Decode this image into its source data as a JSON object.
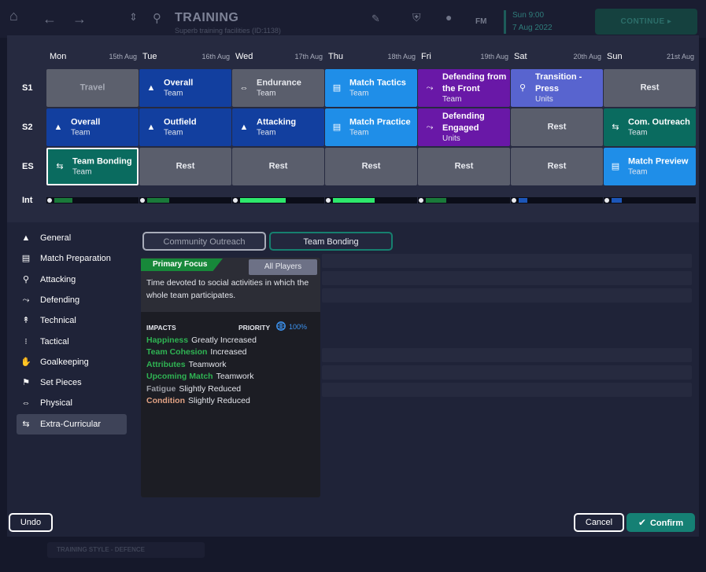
{
  "header": {
    "title": "TRAINING",
    "subtitle": "Superb training facilities (ID:1138)",
    "date_line1": "Sun 9:00",
    "date_line2": "7 Aug 2022",
    "fm": "FM",
    "continue_label": "CONTINUE"
  },
  "footer_bg": "TRAINING STYLE - DEFENCE",
  "days": [
    {
      "name": "Mon",
      "date": "15th Aug"
    },
    {
      "name": "Tue",
      "date": "16th Aug"
    },
    {
      "name": "Wed",
      "date": "17th Aug"
    },
    {
      "name": "Thu",
      "date": "18th Aug"
    },
    {
      "name": "Fri",
      "date": "19th Aug"
    },
    {
      "name": "Sat",
      "date": "20th Aug"
    },
    {
      "name": "Sun",
      "date": "21st Aug"
    }
  ],
  "row_labels": {
    "s1": "S1",
    "s2": "S2",
    "es": "ES",
    "int": "Int"
  },
  "sessions": {
    "s1": [
      {
        "name": "Travel",
        "tag": ""
      },
      {
        "name": "Overall",
        "tag": "Team"
      },
      {
        "name": "Endurance",
        "tag": "Team"
      },
      {
        "name": "Match Tactics",
        "tag": "Team"
      },
      {
        "name": "Defending from the Front",
        "tag": "Team"
      },
      {
        "name": "Transition - Press",
        "tag": "Units"
      },
      {
        "name": "Rest",
        "tag": ""
      }
    ],
    "s2": [
      {
        "name": "Overall",
        "tag": "Team"
      },
      {
        "name": "Outfield",
        "tag": "Team"
      },
      {
        "name": "Attacking",
        "tag": "Team"
      },
      {
        "name": "Match Practice",
        "tag": "Team"
      },
      {
        "name": "Defending Engaged",
        "tag": "Units"
      },
      {
        "name": "Rest",
        "tag": ""
      },
      {
        "name": "Com. Outreach",
        "tag": "Team"
      }
    ],
    "es": [
      {
        "name": "Team Bonding",
        "tag": "Team"
      },
      {
        "name": "Rest",
        "tag": ""
      },
      {
        "name": "Rest",
        "tag": ""
      },
      {
        "name": "Rest",
        "tag": ""
      },
      {
        "name": "Rest",
        "tag": ""
      },
      {
        "name": "Rest",
        "tag": ""
      },
      {
        "name": "Match Preview",
        "tag": "Team"
      }
    ]
  },
  "intensity": [
    {
      "level": 0.22,
      "color": "#1a7a3a"
    },
    {
      "level": 0.27,
      "color": "#1a7a3a"
    },
    {
      "level": 0.55,
      "color": "#2ee86c"
    },
    {
      "level": 0.5,
      "color": "#2ee86c"
    },
    {
      "level": 0.25,
      "color": "#1a7a3a"
    },
    {
      "level": 0.1,
      "color": "#1c56b8"
    },
    {
      "level": 0.12,
      "color": "#1c56b8"
    }
  ],
  "categories": [
    {
      "label": "General",
      "icon": "cone-icon"
    },
    {
      "label": "Match Preparation",
      "icon": "clipboard-icon"
    },
    {
      "label": "Attacking",
      "icon": "running-icon"
    },
    {
      "label": "Defending",
      "icon": "tackle-icon"
    },
    {
      "label": "Technical",
      "icon": "kick-icon"
    },
    {
      "label": "Tactical",
      "icon": "tactics-icon"
    },
    {
      "label": "Goalkeeping",
      "icon": "goalkeeper-icon"
    },
    {
      "label": "Set Pieces",
      "icon": "flag-icon"
    },
    {
      "label": "Physical",
      "icon": "dumbbell-icon"
    },
    {
      "label": "Extra-Curricular",
      "icon": "group-icon"
    }
  ],
  "tabs": {
    "community": "Community Outreach",
    "bonding": "Team Bonding"
  },
  "detail": {
    "primary_focus": "Primary Focus",
    "all_players": "All Players",
    "description": "Time devoted to social activities in which the whole team participates.",
    "impacts_header": "IMPACTS",
    "priority_header": "PRIORITY",
    "priority_value": "100%",
    "impacts": [
      {
        "key": "Happiness",
        "value": "Greatly Increased",
        "color": "#2fb353"
      },
      {
        "key": "Team Cohesion",
        "value": "Increased",
        "color": "#2fb353"
      },
      {
        "key": "Attributes",
        "value": "Teamwork",
        "color": "#2fb353"
      },
      {
        "key": "Upcoming Match",
        "value": "Teamwork",
        "color": "#2fb353"
      },
      {
        "key": "Fatigue",
        "value": "Slightly Reduced",
        "color": "#9a9ca4"
      },
      {
        "key": "Condition",
        "value": "Slightly Reduced",
        "color": "#e0a183"
      }
    ]
  },
  "buttons": {
    "undo": "Undo",
    "cancel": "Cancel",
    "confirm": "Confirm"
  }
}
